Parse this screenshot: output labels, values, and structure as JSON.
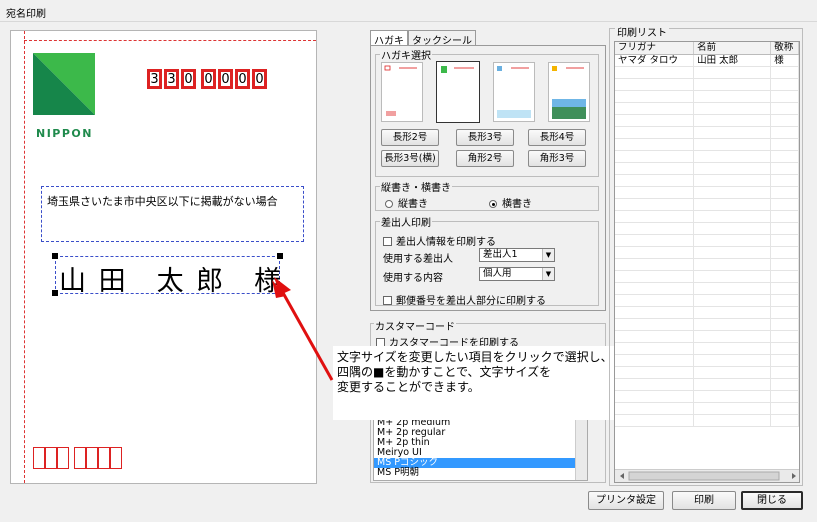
{
  "window": {
    "title": "宛名印刷"
  },
  "preview": {
    "logo_text": "NIPPON",
    "zip_digits": [
      "3",
      "3",
      "0",
      "0",
      "0",
      "0",
      "0"
    ],
    "address": "埼玉県さいたま市中央区以下に掲載がない場合",
    "name": "山 田　太 郎　様"
  },
  "tabs": [
    "ハガキ",
    "タックシール"
  ],
  "hagaki": {
    "group_title": "ハガキ選択",
    "buttons": [
      "長形2号",
      "長形3号",
      "長形4号",
      "長形3号(横)",
      "角形2号",
      "角形3号"
    ]
  },
  "orientation": {
    "group_title": "縦書き・横書き",
    "options": [
      "縦書き",
      "横書き"
    ],
    "selected": "横書き"
  },
  "sender": {
    "group_title": "差出人印刷",
    "print_sender_label": "差出人情報を印刷する",
    "sender_label": "使用する差出人",
    "sender_value": "差出人1",
    "content_label": "使用する内容",
    "content_value": "個人用",
    "zip_label": "郵便番号を差出人部分に印刷する"
  },
  "customer_code": {
    "group_title": "カスタマーコード",
    "print_label": "カスタマーコードを印刷する"
  },
  "font_list": {
    "items": [
      "M+ 2p medium",
      "M+ 2p regular",
      "M+ 2p thin",
      "Meiryo UI",
      "MS Pゴシック",
      "MS P明朝"
    ],
    "selected_index": 4
  },
  "tooltip": {
    "line1": "文字サイズを変更したい項目をクリックで選択し、",
    "line2": "四隅の■を動かすことで、文字サイズを",
    "line3": "変更することができます。"
  },
  "print_list": {
    "group_title": "印刷リスト",
    "columns": [
      "フリガナ",
      "名前",
      "敬称"
    ],
    "rows": [
      [
        "ヤマダ タロウ",
        "山田 太郎",
        "様"
      ]
    ]
  },
  "footer": {
    "printer_settings": "プリンタ設定",
    "print": "印刷",
    "close": "閉じる"
  },
  "colors": {
    "accent_red": "#d22222",
    "guide_blue": "#3a4ec9",
    "logo_green": "#1f8a4c"
  }
}
